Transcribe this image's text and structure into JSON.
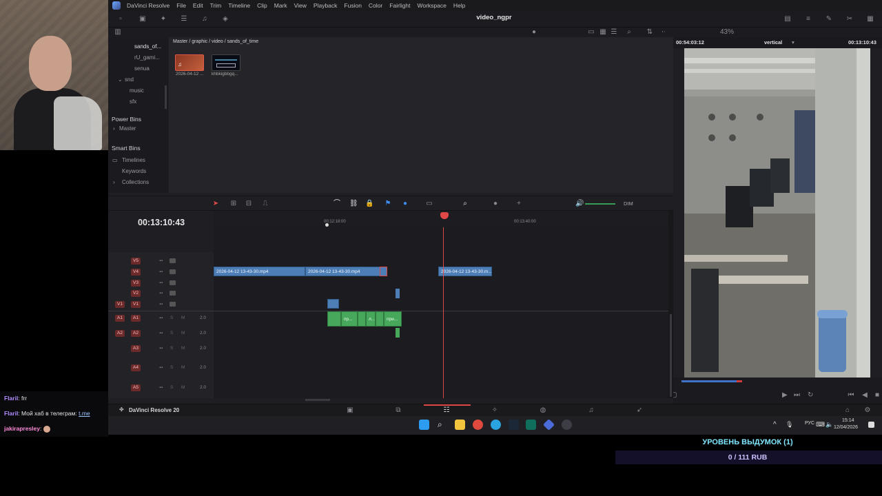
{
  "app": {
    "name": "DaVinci Resolve",
    "menu": [
      "File",
      "Edit",
      "Trim",
      "Timeline",
      "Clip",
      "Mark",
      "View",
      "Playback",
      "Fusion",
      "Color",
      "Fairlight",
      "Workspace",
      "Help"
    ],
    "project_title": "video_ngpr",
    "footer_label": "DaVinci Resolve 20"
  },
  "media_pool": {
    "breadcrumb": "Master / graphic / video / sands_of_time",
    "zoom": "43%",
    "bins": [
      {
        "label": "sands_of...",
        "state": "selected"
      },
      {
        "label": "rU_gami..."
      },
      {
        "label": "senua"
      },
      {
        "label": "snd"
      },
      {
        "label": "music"
      },
      {
        "label": "sfx"
      }
    ],
    "power_bins_title": "Power Bins",
    "power_bins_master": "Master",
    "smart_bins_title": "Smart Bins",
    "smart_bins": [
      "Timelines",
      "Keywords",
      "Collections"
    ],
    "clips": [
      {
        "label": "2026-04-12 ...",
        "kind": "audio"
      },
      {
        "label": "khbkigbbgq..."
      }
    ]
  },
  "viewer": {
    "source_timecode": "00:54:03:12",
    "mode": "vertical",
    "record_timecode": "00:13:10:43"
  },
  "timeline": {
    "timecode": "00:13:10:43",
    "ruler_labels": [
      "00:12:18:00",
      "00:13:40:00"
    ],
    "dim_label": "DIM",
    "video_tracks": [
      "V5",
      "V4",
      "V3",
      "V2",
      "V1"
    ],
    "audio_tracks": [
      {
        "name": "A1",
        "level": "2.0"
      },
      {
        "name": "A2",
        "level": "2.0"
      },
      {
        "name": "A3",
        "level": "2.0"
      },
      {
        "name": "A4",
        "level": "2.0"
      },
      {
        "name": "A5",
        "level": "2.0"
      }
    ],
    "source_v1": "V1",
    "source_a1": "A1",
    "source_a2": "A2",
    "s_label": "S",
    "m_label": "M",
    "clips_v4": [
      {
        "label": "2026-04-12 13-43-30.mp4"
      },
      {
        "label": "2026-04-12 13-43-30.mp4"
      },
      {
        "label": "2026-04-12 13-43-30.m..."
      }
    ],
    "audio_clip_labels": [
      "пр...",
      "л...",
      "при..."
    ]
  },
  "taskbar": {
    "lang": "РУС",
    "time": "15:14",
    "date": "12/04/2026"
  },
  "chat": [
    {
      "user": "Flaril",
      "text": "frr"
    },
    {
      "user": "Flaril",
      "text": "Мой хаб в телеграм:",
      "link": "t.me"
    },
    {
      "user": "jakirapresley",
      "text": ""
    }
  ],
  "donation": {
    "title": "УРОВЕНЬ ВЫДУМОК (1)",
    "amount": "0 / 111 RUB"
  }
}
